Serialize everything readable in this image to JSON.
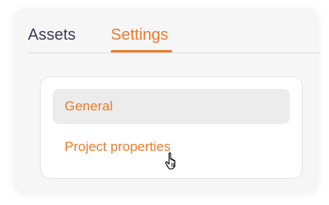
{
  "tabs": [
    {
      "label": "Assets"
    },
    {
      "label": "Settings",
      "active": true
    }
  ],
  "menu": {
    "items": [
      {
        "label": "General",
        "selected": true
      },
      {
        "label": "Project properties",
        "hovered": true
      }
    ]
  },
  "colors": {
    "accent": "#ef7a2b",
    "tab_inactive": "#3f3a5c",
    "selected_bg": "#ececec",
    "panel_bg": "#f6f6f6"
  },
  "icons": {
    "cursor": "hand-pointer-icon"
  }
}
